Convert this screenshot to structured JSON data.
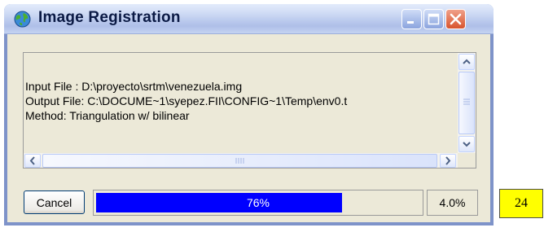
{
  "window": {
    "title": "Image Registration",
    "icons": {
      "app": "globe-icon",
      "minimize": "minimize-icon",
      "maximize": "maximize-icon",
      "close": "close-icon"
    }
  },
  "log": {
    "lines": [
      "Input File : D:\\proyecto\\srtm\\venezuela.img",
      "Output File: C:\\DOCUME~1\\syepez.FII\\CONFIG~1\\Temp\\env0.t",
      "Method: Triangulation w/ bilinear"
    ]
  },
  "controls": {
    "cancel_label": "Cancel",
    "progress": {
      "value": 0.76,
      "label": "76%"
    },
    "secondary_percent": "4.0%"
  },
  "tag": {
    "text": "24"
  },
  "colors": {
    "progress_fill": "#0000ff",
    "close_button": "#d8542e",
    "tag_background": "#ffff00"
  }
}
